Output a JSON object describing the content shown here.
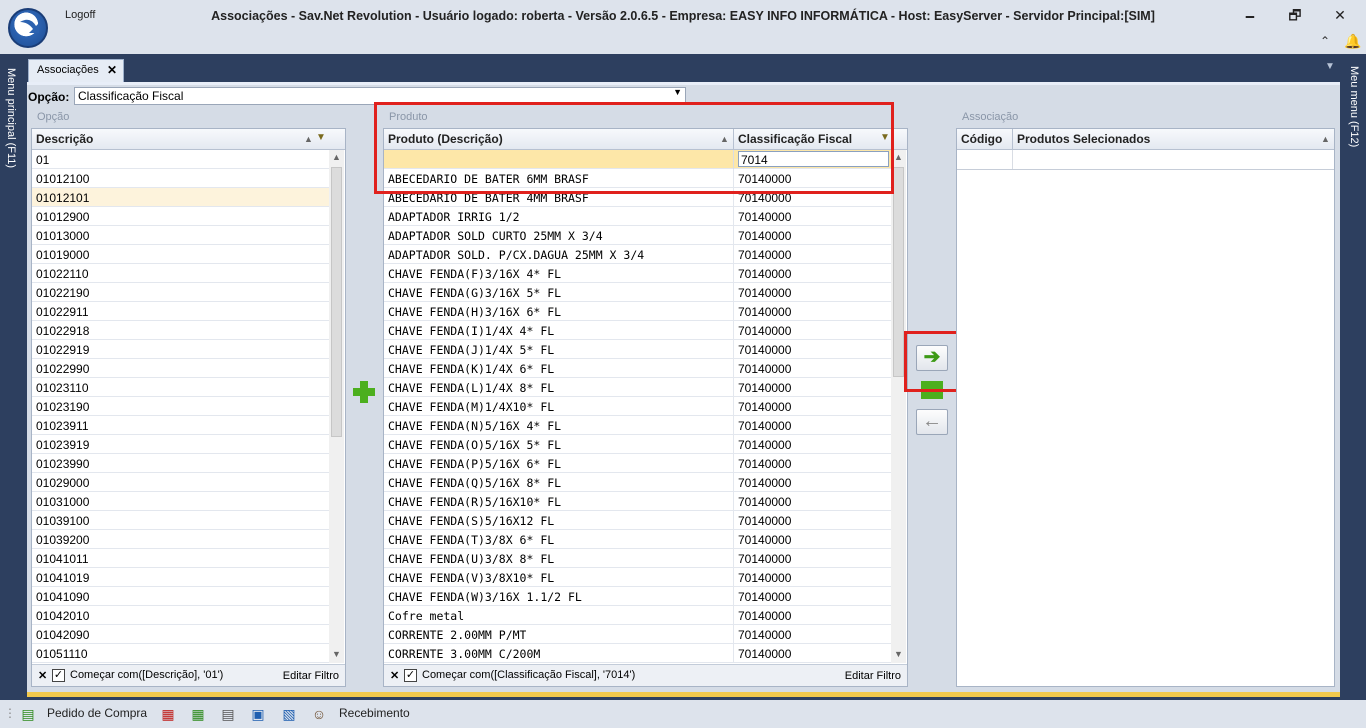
{
  "titlebar": {
    "logoff": "Logoff",
    "title": "Associações - Sav.Net Revolution - Usuário logado: roberta - Versão 2.0.6.5 - Empresa: EASY INFO INFORMÁTICA - Host: EasyServer - Servidor Principal:[SIM]",
    "minimize": "🗕",
    "restore": "🗗",
    "close": "✕"
  },
  "side": {
    "left_menu": "Menu principal (F11)",
    "right_menu": "Meu menu (F12)"
  },
  "tab": {
    "label": "Associações",
    "close": "✕"
  },
  "opcao": {
    "label": "Opção:",
    "value": "Classificação Fiscal"
  },
  "left_panel": {
    "group_title": "Opção",
    "header": "Descrição",
    "filter_value": "01",
    "rows": [
      "01012100",
      "01012101",
      "01012900",
      "01013000",
      "01019000",
      "01022110",
      "01022190",
      "01022911",
      "01022918",
      "01022919",
      "01022990",
      "01023110",
      "01023190",
      "01023911",
      "01023919",
      "01023990",
      "01029000",
      "01031000",
      "01039100",
      "01039200",
      "01041011",
      "01041019",
      "01041090",
      "01042010",
      "01042090",
      "01051110"
    ],
    "footer_text": "Começar com([Descrição], '01')",
    "footer_edit": "Editar Filtro"
  },
  "mid_panel": {
    "group_title": "Produto",
    "header_desc": "Produto (Descrição)",
    "header_class": "Classificação Fiscal",
    "filter_desc": "",
    "filter_class": "7014",
    "rows": [
      {
        "desc": "ABECEDARIO DE BATER 6MM BRASF",
        "class": "70140000"
      },
      {
        "desc": "ABECEDARIO DE BATER 4MM BRASF",
        "class": "70140000"
      },
      {
        "desc": "ADAPTADOR IRRIG 1/2",
        "class": "70140000"
      },
      {
        "desc": "ADAPTADOR SOLD CURTO 25MM X 3/4",
        "class": "70140000"
      },
      {
        "desc": "ADAPTADOR SOLD. P/CX.DAGUA 25MM X 3/4",
        "class": "70140000"
      },
      {
        "desc": "CHAVE FENDA(F)3/16X 4* FL",
        "class": "70140000"
      },
      {
        "desc": "CHAVE FENDA(G)3/16X 5* FL",
        "class": "70140000"
      },
      {
        "desc": "CHAVE FENDA(H)3/16X 6* FL",
        "class": "70140000"
      },
      {
        "desc": "CHAVE FENDA(I)1/4X 4* FL",
        "class": "70140000"
      },
      {
        "desc": "CHAVE FENDA(J)1/4X 5* FL",
        "class": "70140000"
      },
      {
        "desc": "CHAVE FENDA(K)1/4X 6* FL",
        "class": "70140000"
      },
      {
        "desc": "CHAVE FENDA(L)1/4X 8* FL",
        "class": "70140000"
      },
      {
        "desc": "CHAVE FENDA(M)1/4X10* FL",
        "class": "70140000"
      },
      {
        "desc": "CHAVE FENDA(N)5/16X 4* FL",
        "class": "70140000"
      },
      {
        "desc": "CHAVE FENDA(O)5/16X 5* FL",
        "class": "70140000"
      },
      {
        "desc": "CHAVE FENDA(P)5/16X 6* FL",
        "class": "70140000"
      },
      {
        "desc": "CHAVE FENDA(Q)5/16X 8* FL",
        "class": "70140000"
      },
      {
        "desc": "CHAVE FENDA(R)5/16X10* FL",
        "class": "70140000"
      },
      {
        "desc": "CHAVE FENDA(S)5/16X12 FL",
        "class": "70140000"
      },
      {
        "desc": "CHAVE FENDA(T)3/8X 6* FL",
        "class": "70140000"
      },
      {
        "desc": "CHAVE FENDA(U)3/8X 8* FL",
        "class": "70140000"
      },
      {
        "desc": "CHAVE FENDA(V)3/8X10* FL",
        "class": "70140000"
      },
      {
        "desc": "CHAVE FENDA(W)3/16X 1.1/2 FL",
        "class": "70140000"
      },
      {
        "desc": "Cofre metal",
        "class": "70140000"
      },
      {
        "desc": "CORRENTE 2.00MM P/MT",
        "class": "70140000"
      },
      {
        "desc": "CORRENTE 3.00MM C/200M",
        "class": "70140000"
      }
    ],
    "footer_text": "Começar com([Classificação Fiscal], '7014')",
    "footer_edit": "Editar Filtro"
  },
  "right_panel": {
    "group_title": "Associação",
    "header_code": "Código",
    "header_products": "Produtos Selecionados"
  },
  "buttons": {
    "add_icon": "plus-icon",
    "assoc_right": "➔",
    "assoc_left": "←"
  },
  "taskbar": {
    "pedido": "Pedido de Compra",
    "recebimento": "Recebimento"
  },
  "colors": {
    "highlight": "#fde7a8",
    "red_frame": "#e0211d",
    "green": "#4caf1e"
  }
}
